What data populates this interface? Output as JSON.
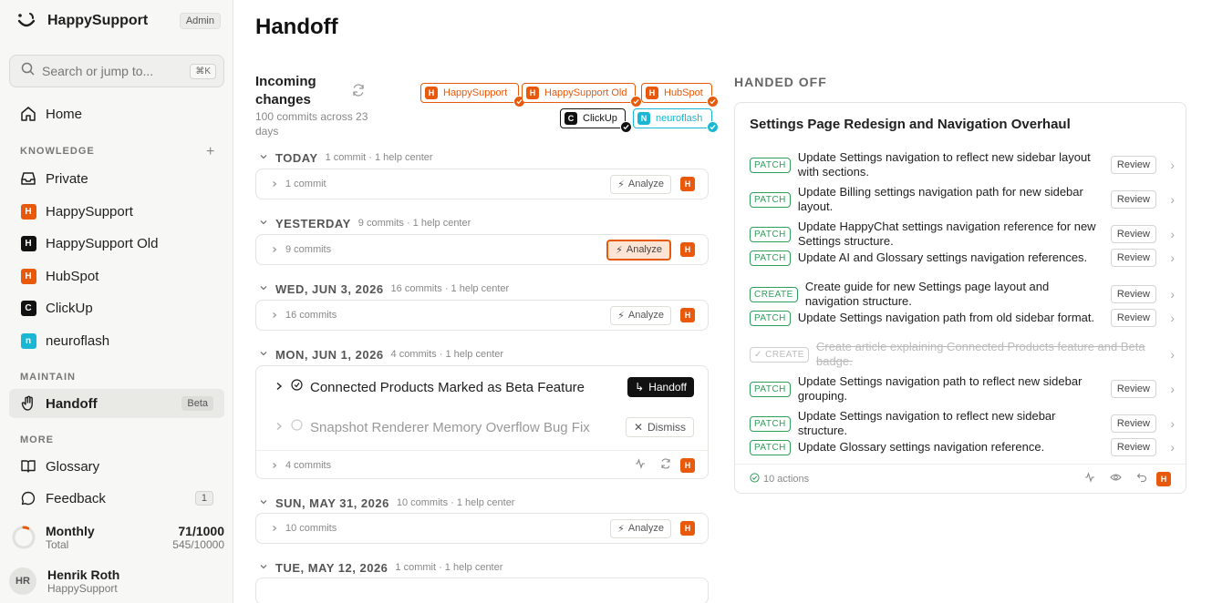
{
  "sidebar": {
    "brand": "HappySupport",
    "admin_badge": "Admin",
    "search_placeholder": "Search or jump to...",
    "search_shortcut": "⌘K",
    "home": "Home",
    "knowledge_label": "KNOWLEDGE",
    "knowledge_items": [
      {
        "label": "Private",
        "icon": "inbox-icon"
      },
      {
        "label": "HappySupport",
        "icon": "H",
        "color": "#e8590c"
      },
      {
        "label": "HappySupport Old",
        "icon": "H",
        "color": "#111111"
      },
      {
        "label": "HubSpot",
        "icon": "H",
        "color": "#e8590c"
      },
      {
        "label": "ClickUp",
        "icon": "C",
        "color": "#111111"
      },
      {
        "label": "neuroflash",
        "icon": "n",
        "color": "#1ab7d4"
      }
    ],
    "maintain_label": "MAINTAIN",
    "handoff": "Handoff",
    "beta_badge": "Beta",
    "more_label": "MORE",
    "glossary": "Glossary",
    "feedback": "Feedback",
    "feedback_count": "1",
    "usage": {
      "title": "Monthly",
      "value": "71/1000",
      "sub": "Total",
      "sub_value": "545/10000",
      "progress": 0.071
    },
    "user": {
      "initials": "HR",
      "name": "Henrik Roth",
      "org": "HappySupport"
    }
  },
  "main": {
    "title": "Handoff",
    "incoming_title": "Incoming changes",
    "incoming_sub": "100 commits across 23 days",
    "sources": [
      {
        "label": "HappySupport",
        "letter": "H",
        "style": "orange"
      },
      {
        "label": "HappySupport Old",
        "letter": "H",
        "style": "orange"
      },
      {
        "label": "HubSpot",
        "letter": "H",
        "style": "orange"
      },
      {
        "label": "ClickUp",
        "letter": "C",
        "style": "black"
      },
      {
        "label": "neuroflash",
        "letter": "N",
        "style": "teal"
      }
    ],
    "days": [
      {
        "label": "TODAY",
        "meta": "1 commit · 1 help center",
        "commits": "1 commit",
        "analyze": "Analyze"
      },
      {
        "label": "YESTERDAY",
        "meta": "9 commits · 1 help center",
        "commits": "9 commits",
        "analyze": "Analyze"
      },
      {
        "label": "WED, JUN 3, 2026",
        "meta": "16 commits · 1 help center",
        "commits": "16 commits",
        "analyze": "Analyze"
      },
      {
        "label": "MON, JUN 1, 2026",
        "meta": "4 commits · 1 help center",
        "commits": "4 commits"
      },
      {
        "label": "SUN, MAY 31, 2026",
        "meta": "10 commits · 1 help center",
        "commits": "10 commits",
        "analyze": "Analyze"
      },
      {
        "label": "TUE, MAY 12, 2026",
        "meta": "1 commit · 1 help center"
      }
    ],
    "stories": [
      {
        "title": "Connected Products Marked as Beta Feature",
        "action": "Handoff"
      },
      {
        "title": "Snapshot Renderer Memory Overflow Bug Fix",
        "action": "Dismiss"
      }
    ],
    "hs_letter": "H"
  },
  "handed_off": {
    "label": "HANDED OFF",
    "title": "Settings Page Redesign and Navigation Overhaul",
    "review_label": "Review",
    "actions": [
      {
        "tag": "PATCH",
        "text": "Update Settings navigation to reflect new sidebar layout with sections."
      },
      {
        "tag": "PATCH",
        "text": "Update Billing settings navigation path for new sidebar layout."
      },
      {
        "tag": "PATCH",
        "text": "Update HappyChat settings navigation reference for new Settings structure."
      },
      {
        "tag": "PATCH",
        "text": "Update AI and Glossary settings navigation references."
      },
      {
        "tag": "CREATE",
        "text": "Create guide for new Settings page layout and navigation structure."
      },
      {
        "tag": "PATCH",
        "text": "Update Settings navigation path from old sidebar format."
      },
      {
        "tag": "CREATE",
        "text": "Create article explaining Connected Products feature and Beta badge.",
        "done": true
      },
      {
        "tag": "PATCH",
        "text": "Update Settings navigation path to reflect new sidebar grouping."
      },
      {
        "tag": "PATCH",
        "text": "Update Settings navigation to reflect new sidebar structure."
      },
      {
        "tag": "PATCH",
        "text": "Update Glossary settings navigation reference."
      }
    ],
    "footer": "10 actions"
  }
}
